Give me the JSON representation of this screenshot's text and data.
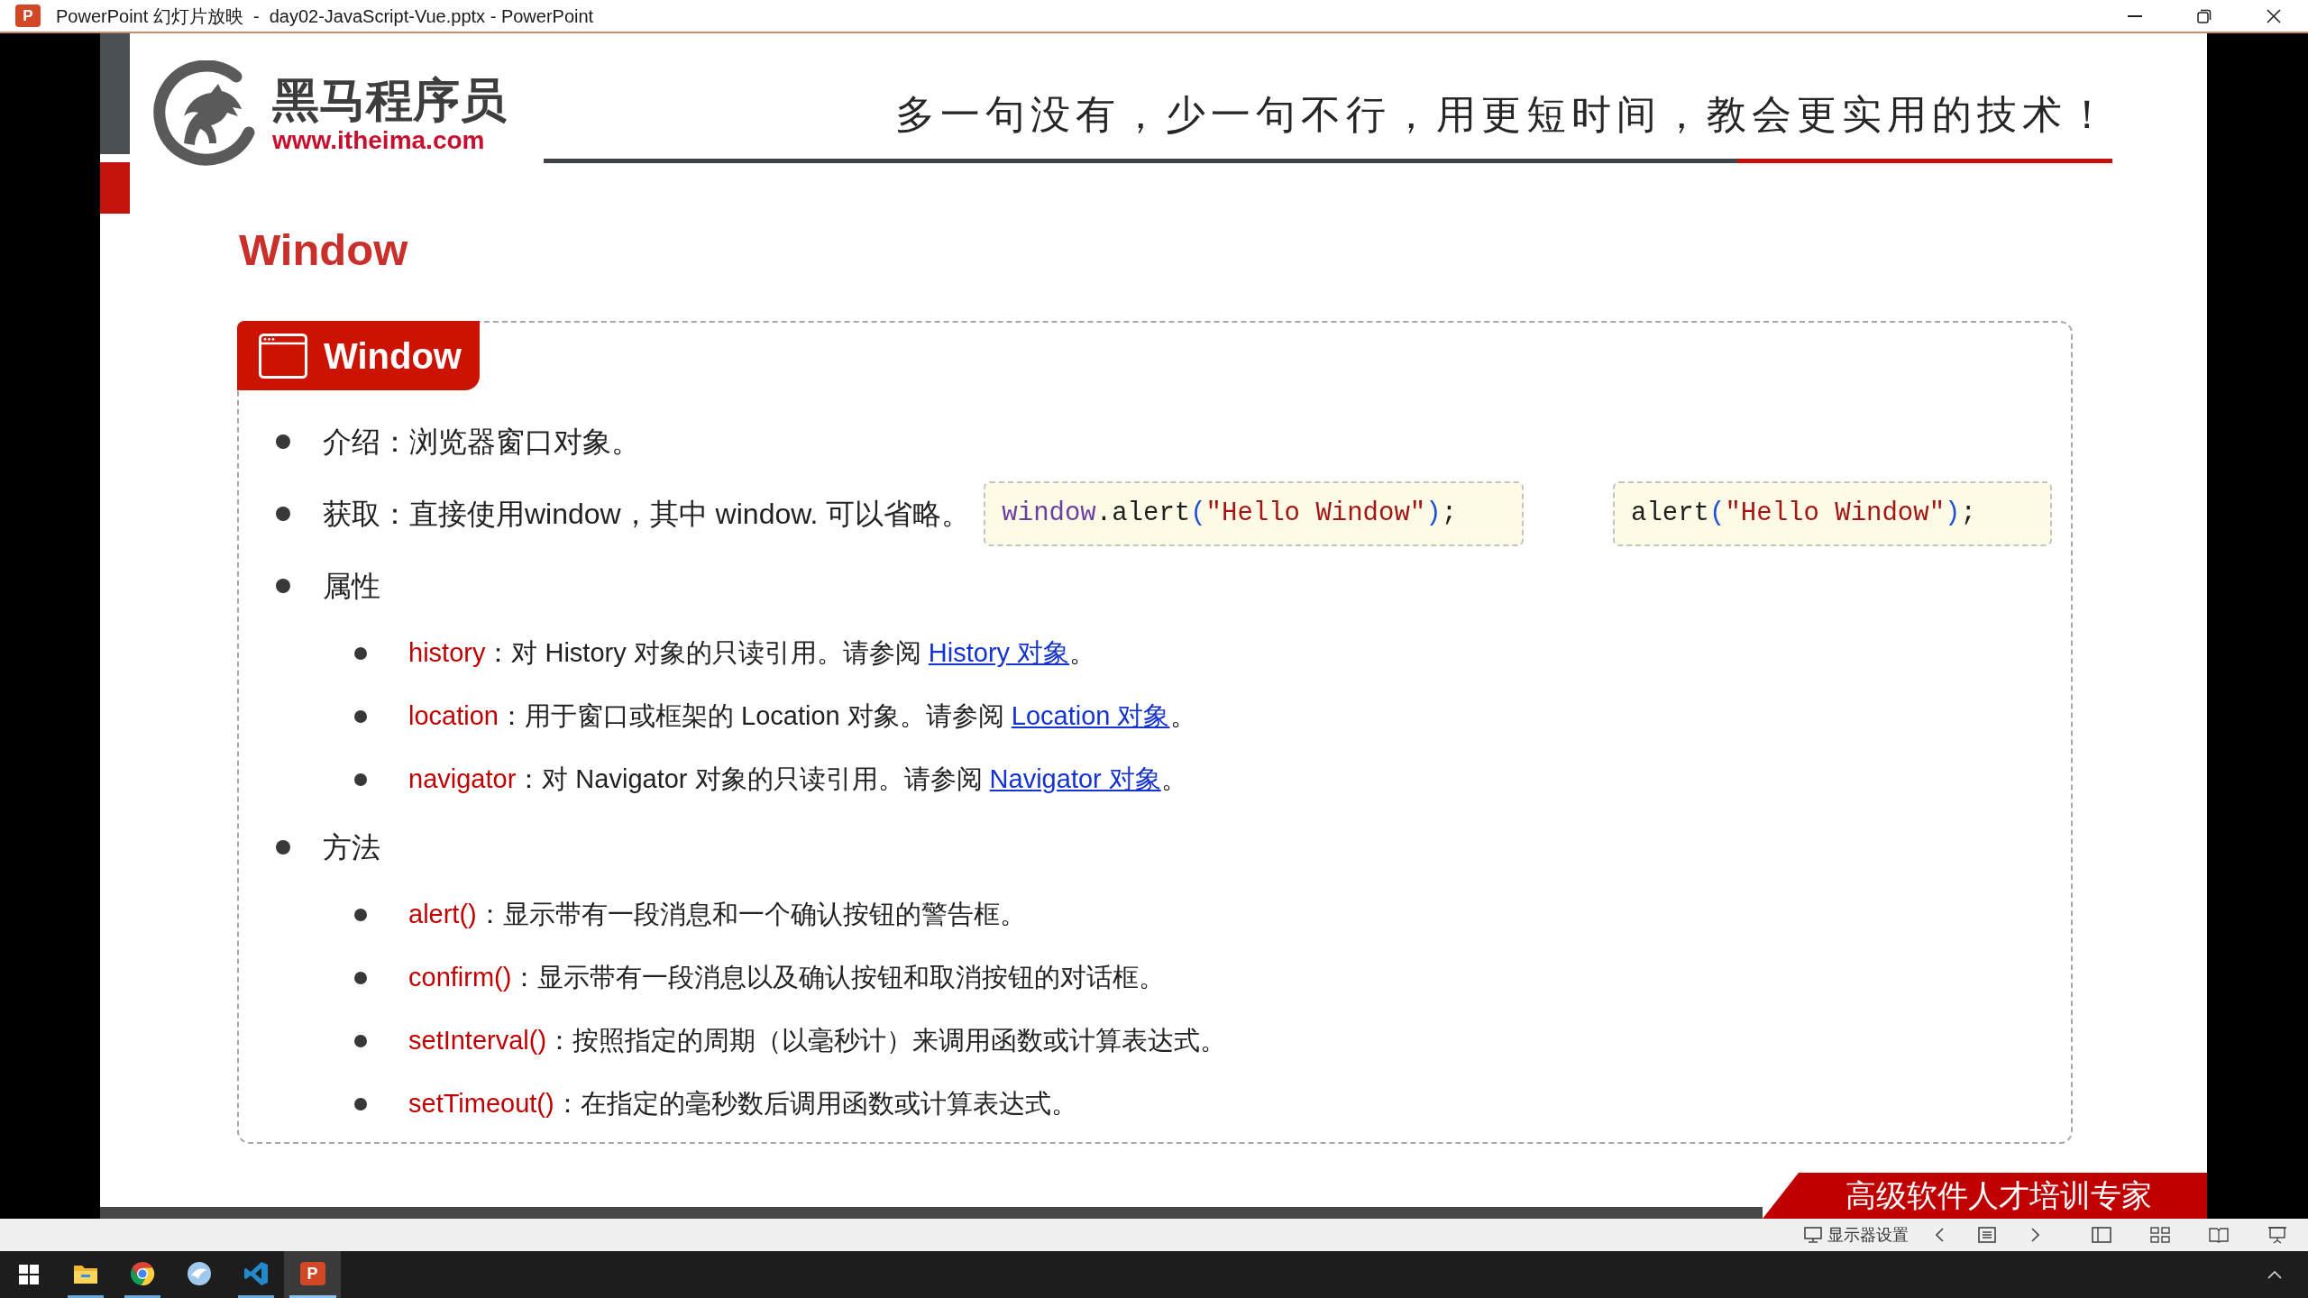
{
  "window": {
    "title": "PowerPoint 幻灯片放映  -  day02-JavaScript-Vue.pptx - PowerPoint",
    "icon_letter": "P"
  },
  "slide": {
    "logo": {
      "name": "黑马程序员",
      "url": "www.itheima.com"
    },
    "slogan": "多一句没有，少一句不行，用更短时间，教会更实用的技术！",
    "title": "Window",
    "card": {
      "badge": "Window",
      "items": [
        {
          "text": "介绍：浏览器窗口对象。"
        },
        {
          "text": "获取：直接使用window，其中 window. 可以省略。",
          "code_snippets": [
            {
              "tokens": [
                {
                  "kind": "object",
                  "text": "window"
                },
                {
                  "kind": "plain",
                  "text": ".alert"
                },
                {
                  "kind": "paren",
                  "text": "("
                },
                {
                  "kind": "string",
                  "text": "\"Hello Window\""
                },
                {
                  "kind": "paren",
                  "text": ")"
                },
                {
                  "kind": "plain",
                  "text": ";"
                }
              ]
            },
            {
              "tokens": [
                {
                  "kind": "plain",
                  "text": "alert"
                },
                {
                  "kind": "paren",
                  "text": "("
                },
                {
                  "kind": "string",
                  "text": "\"Hello Window\""
                },
                {
                  "kind": "paren",
                  "text": ")"
                },
                {
                  "kind": "plain",
                  "text": ";"
                }
              ]
            }
          ]
        },
        {
          "text": "属性",
          "children": [
            {
              "term": "history",
              "text": "：对 History 对象的只读引用。请参阅 ",
              "link": "History 对象",
              "tail": "。"
            },
            {
              "term": "location",
              "text": "：用于窗口或框架的 Location 对象。请参阅 ",
              "link": "Location 对象",
              "tail": "。"
            },
            {
              "term": "navigator",
              "text": "：对 Navigator 对象的只读引用。请参阅 ",
              "link": "Navigator 对象",
              "tail": "。"
            }
          ]
        },
        {
          "text": "方法",
          "children": [
            {
              "term": "alert()",
              "text": "：显示带有一段消息和一个确认按钮的警告框。"
            },
            {
              "term": "confirm()",
              "text": "：显示带有一段消息以及确认按钮和取消按钮的对话框。"
            },
            {
              "term": "setInterval()",
              "text": "：按照指定的周期（以毫秒计）来调用函数或计算表达式。"
            },
            {
              "term": "setTimeout()",
              "text": "：在指定的毫秒数后调用函数或计算表达式。"
            }
          ]
        }
      ]
    },
    "footer_banner": "高级软件人才培训专家"
  },
  "slideshow_toolbar": {
    "display_settings": "显示器设置"
  },
  "taskbar": {
    "apps": [
      {
        "kind": "file_explorer",
        "running": true,
        "selected": false
      },
      {
        "kind": "browser",
        "running": true,
        "selected": false
      },
      {
        "kind": "round_app",
        "running": false,
        "selected": false
      },
      {
        "kind": "code_editor",
        "running": true,
        "selected": false
      },
      {
        "kind": "presentation",
        "letter": "P",
        "running": true,
        "selected": true
      }
    ]
  }
}
